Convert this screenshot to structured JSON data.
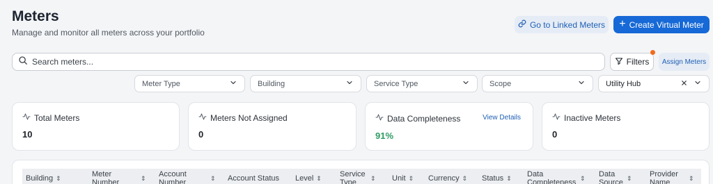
{
  "header": {
    "title": "Meters",
    "subtitle": "Manage and monitor all meters across your portfolio",
    "linked_label": "Go to Linked Meters",
    "create_label": "Create Virtual Meter"
  },
  "search": {
    "placeholder": "Search meters..."
  },
  "toolbar": {
    "filters_label": "Filters",
    "assign_label": "Assign Meters"
  },
  "dropdowns": [
    {
      "label": "Meter Type"
    },
    {
      "label": "Building"
    },
    {
      "label": "Service Type"
    },
    {
      "label": "Scope"
    },
    {
      "label": "Utility Hub"
    }
  ],
  "cards": [
    {
      "title": "Total Meters",
      "value": "10"
    },
    {
      "title": "Meters Not Assigned",
      "value": "0"
    },
    {
      "title": "Data Completeness",
      "value": "91%",
      "link": "View Details"
    },
    {
      "title": "Inactive Meters",
      "value": "0"
    }
  ],
  "table": {
    "columns": [
      "Building",
      "Meter Number",
      "Account Number",
      "Account Status",
      "Level",
      "Service Type",
      "Unit",
      "Currency",
      "Status",
      "Data Completeness",
      "Data Source",
      "Provider Name"
    ]
  },
  "colors": {
    "accent": "#1669d6",
    "notification_dot": "#f26b1d",
    "positive": "#2e9a63"
  },
  "icons": [
    "link-icon",
    "plus-icon",
    "search-icon",
    "filter-icon",
    "chevron-down-icon",
    "close-icon",
    "activity-icon",
    "sort-icon"
  ]
}
